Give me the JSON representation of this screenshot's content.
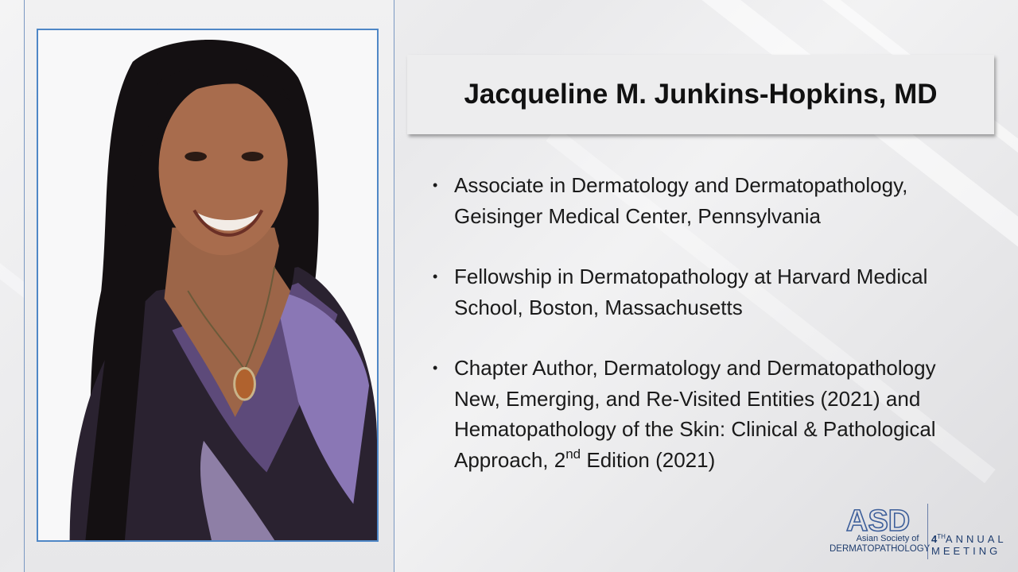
{
  "slide": {
    "title": "Jacqueline M. Junkins-Hopkins, MD",
    "bullets": [
      "Associate in Dermatology and Dermatopathology, Geisinger Medical Center, Pennsylvania",
      "Fellowship in Dermatopathology at Harvard Medical School, Boston, Massachusetts"
    ],
    "bullet3": {
      "text_a": "Chapter Author, Dermatology and Dermatopathology New, Emerging, and Re-Visited Entities (2021) and Hematopathology of the Skin: Clinical & Pathological Approach, 2",
      "sup": "nd",
      "text_b": " Edition (2021)"
    }
  },
  "logo": {
    "mark": "ASD",
    "line1": "Asian Society of",
    "line2": "DERMATOPATHOLOGY",
    "annual_number": "4",
    "annual_sup": "TH",
    "annual_word": "ANNUAL",
    "meeting_word": "MEETING"
  },
  "colors": {
    "frame": "#4f87c6",
    "logo": "#1f3d6e"
  }
}
